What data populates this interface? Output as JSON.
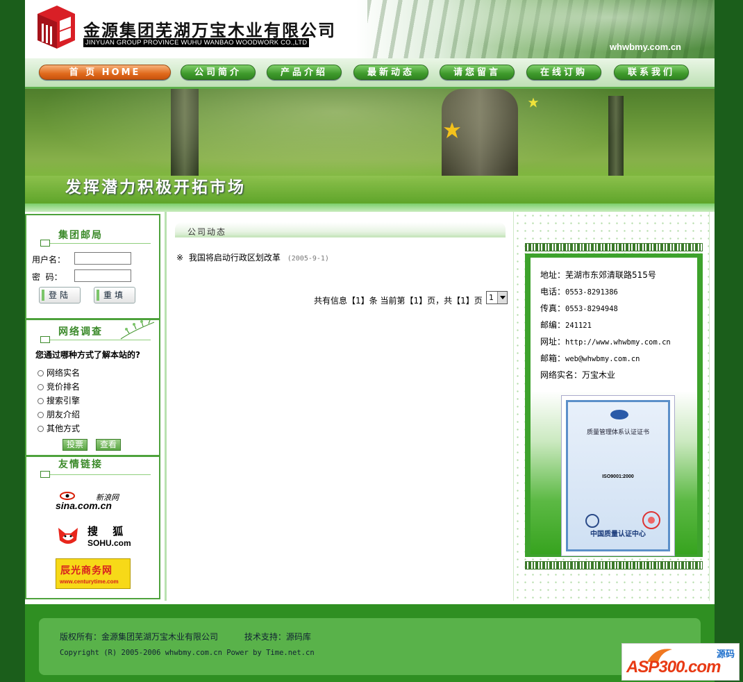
{
  "header": {
    "company_cn": "金源集团芜湖万宝木业有限公司",
    "company_en": "JINYUAN GROUP PROVINCE WUHU WANBAO WOODWORK CO.,LTD",
    "domain": "whwbmy.com.cn"
  },
  "nav": [
    {
      "label": "首 页 HOME"
    },
    {
      "label": "公司简介"
    },
    {
      "label": "产品介绍"
    },
    {
      "label": "最新动态"
    },
    {
      "label": "请您留言"
    },
    {
      "label": "在线订购"
    },
    {
      "label": "联系我们"
    }
  ],
  "banner": {
    "slogan": "发挥潜力积极开拓市场"
  },
  "mail": {
    "title": "集团邮局",
    "user_label": "用户名：",
    "pass_label": "密  码：",
    "login": "登陆",
    "reset": "重填"
  },
  "survey": {
    "title": "网络调查",
    "question": "您通过哪种方式了解本站的?",
    "options": [
      "网络实名",
      "竞价排名",
      "搜索引擎",
      "朋友介绍",
      "其他方式"
    ],
    "vote": "投票",
    "view": "查看"
  },
  "links": {
    "title": "友情链接",
    "sina": "sina.com.cn",
    "sina_cn": "新浪网",
    "sohu_cn": "搜 狐",
    "sohu": "SOHU.com",
    "century": "辰光商务网",
    "century_url": "www.centurytime.com"
  },
  "news": {
    "title": "公司动态",
    "items": [
      {
        "text": "我国将启动行政区划改革",
        "date": "(2005-9-1)"
      }
    ],
    "bullet": "※",
    "pager": "共有信息【1】条 当前第【1】页，共【1】页",
    "page_value": "1"
  },
  "contact": {
    "address": {
      "label": "地址：",
      "value": "芜湖市东郊清联路515号"
    },
    "phone": {
      "label": "电话：",
      "value": "0553-8291386"
    },
    "fax": {
      "label": "传真：",
      "value": "0553-8294948"
    },
    "zip": {
      "label": "邮编：",
      "value": "241121"
    },
    "web": {
      "label": "网址：",
      "value": "http://www.whwbmy.com.cn"
    },
    "email": {
      "label": "邮箱：",
      "value": "web@whwbmy.com.cn"
    },
    "realname": {
      "label": "网络实名：",
      "value": "万宝木业"
    },
    "cert_title": "质量管理体系认证证书",
    "cert_std": "ISO9001:2000",
    "cert_footer": "中国质量认证中心"
  },
  "footer": {
    "copyright": "版权所有：金源集团芜湖万宝木业有限公司",
    "support": "技术支持：源码库",
    "line2": "Copyright (R) 2005-2006 whwbmy.com.cn  Power by Time.net.cn",
    "asp_logo": "ASP300.com",
    "asp_cn": "源码"
  }
}
